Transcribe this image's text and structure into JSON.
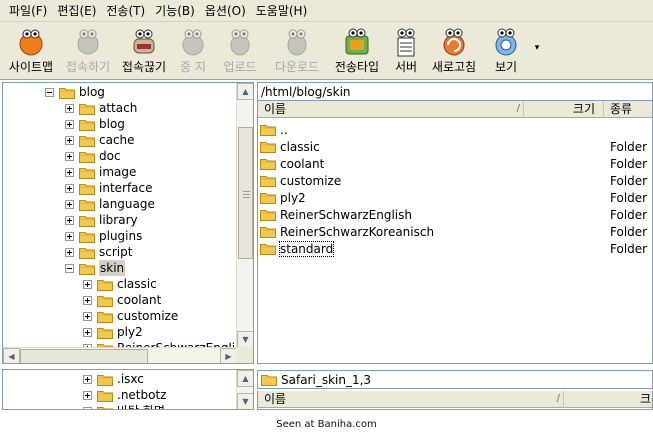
{
  "menu": [
    {
      "label": "파일(F)",
      "key": "file"
    },
    {
      "label": "편집(E)",
      "key": "edit"
    },
    {
      "label": "전송(T)",
      "key": "transfer"
    },
    {
      "label": "기능(B)",
      "key": "function"
    },
    {
      "label": "옵션(O)",
      "key": "options"
    },
    {
      "label": "도움말(H)",
      "key": "help"
    }
  ],
  "toolbar": [
    {
      "label": "사이트맵",
      "icon": "sitemap-icon",
      "enabled": true,
      "color": "#f07c1a"
    },
    {
      "label": "접속하기",
      "icon": "connect-icon",
      "enabled": false,
      "color": "#9a9a9a"
    },
    {
      "label": "접속끊기",
      "icon": "disconnect-icon",
      "enabled": true,
      "color": "#c8b890"
    },
    {
      "label": "중 지",
      "icon": "stop-icon",
      "enabled": false,
      "color": "#9a9a9a"
    },
    {
      "label": "업로드",
      "icon": "upload-icon",
      "enabled": false,
      "color": "#9a9a9a"
    },
    {
      "label": "다운로드",
      "icon": "download-icon",
      "enabled": false,
      "color": "#9a9a9a"
    },
    {
      "label": "전송타입",
      "icon": "transfer-type-icon",
      "enabled": true,
      "color": "#e8a020"
    },
    {
      "label": "서버",
      "icon": "server-icon",
      "enabled": true,
      "color": "#ffffff"
    },
    {
      "label": "새로고침",
      "icon": "refresh-icon",
      "enabled": true,
      "color": "#e87a30"
    },
    {
      "label": "보기",
      "icon": "view-icon",
      "enabled": true,
      "color": "#7ab8e8"
    }
  ],
  "toolbar_more": "▾",
  "remote_tree": {
    "root": "blog",
    "children": [
      {
        "label": "attach",
        "level": 1
      },
      {
        "label": "blog",
        "level": 1
      },
      {
        "label": "cache",
        "level": 1
      },
      {
        "label": "doc",
        "level": 1
      },
      {
        "label": "image",
        "level": 1
      },
      {
        "label": "interface",
        "level": 1
      },
      {
        "label": "language",
        "level": 1
      },
      {
        "label": "library",
        "level": 1
      },
      {
        "label": "plugins",
        "level": 1
      },
      {
        "label": "script",
        "level": 1
      },
      {
        "label": "skin",
        "level": 1,
        "expanded": true,
        "selected": true
      },
      {
        "label": "classic",
        "level": 2
      },
      {
        "label": "coolant",
        "level": 2
      },
      {
        "label": "customize",
        "level": 2
      },
      {
        "label": "ply2",
        "level": 2
      },
      {
        "label": "ReinerSchwarzEnglish",
        "level": 2
      }
    ]
  },
  "local_tree": {
    "children": [
      {
        "label": ".isxc"
      },
      {
        "label": ".netbotz"
      },
      {
        "label": "바탕 화면"
      }
    ]
  },
  "remote_path": "/html/blog/skin",
  "columns": {
    "name": "이름",
    "size": "크기",
    "type": "종류"
  },
  "files": [
    {
      "name": "..",
      "type": ""
    },
    {
      "name": "classic",
      "type": "Folder"
    },
    {
      "name": "coolant",
      "type": "Folder"
    },
    {
      "name": "customize",
      "type": "Folder"
    },
    {
      "name": "ply2",
      "type": "Folder"
    },
    {
      "name": "ReinerSchwarzEnglish",
      "type": "Folder"
    },
    {
      "name": "ReinerSchwarzKoreanisch",
      "type": "Folder"
    },
    {
      "name": "standard",
      "type": "Folder",
      "focused": true
    }
  ],
  "local_path": "Safari_skin_1,3",
  "local_columns": {
    "name": "이름",
    "size": "크"
  },
  "footer": "Seen at Baniha.com",
  "colors": {
    "chrome": "#ece9d8",
    "border": "#7f9db9",
    "folder": "#f2c94c",
    "folder_dark": "#c99a1e"
  }
}
